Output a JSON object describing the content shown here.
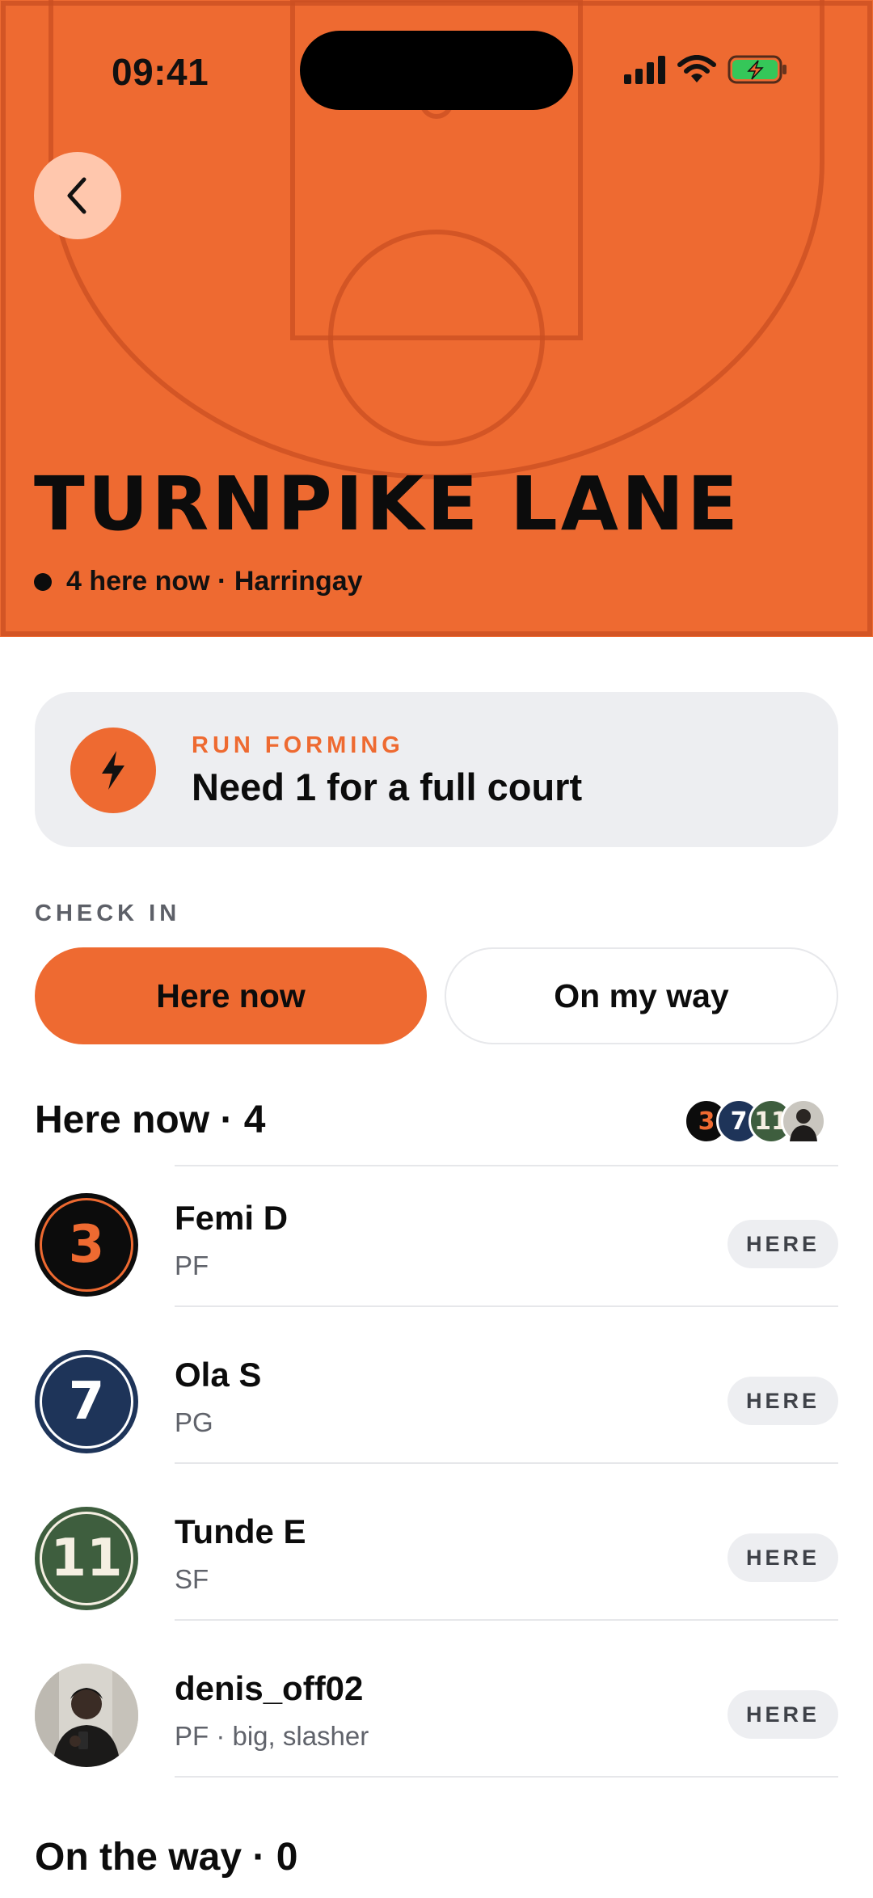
{
  "status_bar": {
    "time": "09:41"
  },
  "hero": {
    "title": "TURNPIKE LANE",
    "subtitle": "4 here now · Harringay",
    "color": "#ee6a31"
  },
  "run_card": {
    "kicker": "RUN FORMING",
    "text": "Need 1 for a full court",
    "icon": "lightning-bolt-icon"
  },
  "check_in": {
    "label": "CHECK IN",
    "here_now_button": "Here now",
    "on_my_way_button": "On my way"
  },
  "here_now_section": {
    "title": "Here now · 4",
    "stack": [
      {
        "label": "3",
        "bg": "#0c0c0c",
        "fg": "#ee6a31"
      },
      {
        "label": "7",
        "bg": "#1e3459",
        "fg": "#ffffff"
      },
      {
        "label": "11",
        "bg": "#3e5e3e",
        "fg": "#f5efe2"
      },
      {
        "label": "",
        "bg": "#c9c6bf",
        "fg": "#222222"
      }
    ],
    "players": [
      {
        "jersey": "3",
        "name": "Femi D",
        "position": "PF",
        "badge": "HERE",
        "bg": "#0c0c0c",
        "fg": "#ee6a31"
      },
      {
        "jersey": "7",
        "name": "Ola S",
        "position": "PG",
        "badge": "HERE",
        "bg": "#1e3459",
        "fg": "#ffffff"
      },
      {
        "jersey": "11",
        "name": "Tunde E",
        "position": "SF",
        "badge": "HERE",
        "bg": "#3e5e3e",
        "fg": "#f5efe2"
      },
      {
        "jersey": "",
        "name": "denis_off02",
        "position": "PF · big, slasher",
        "badge": "HERE",
        "bg": "#cfccc5",
        "fg": "#222222"
      }
    ]
  },
  "on_the_way_section": {
    "title": "On the way · 0"
  }
}
